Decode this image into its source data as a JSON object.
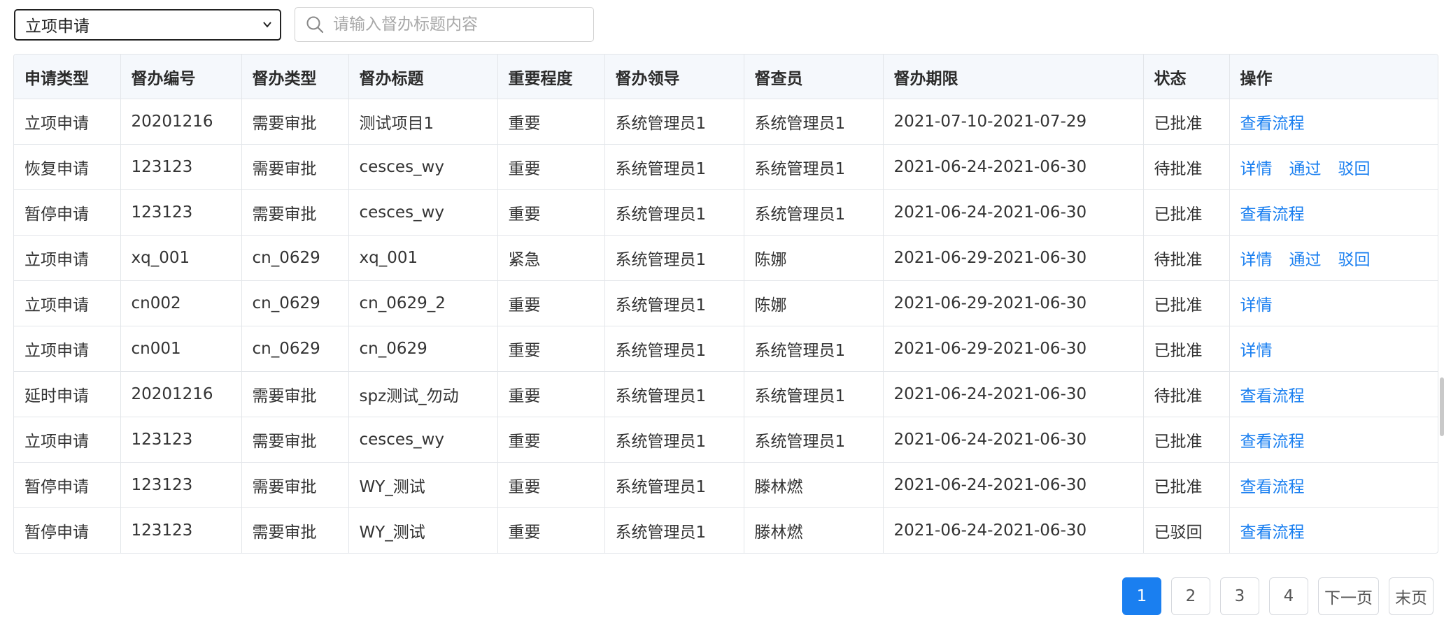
{
  "filter": {
    "selected": "立项申请",
    "search_placeholder": "请输入督办标题内容"
  },
  "table": {
    "columns": [
      "申请类型",
      "督办编号",
      "督办类型",
      "督办标题",
      "重要程度",
      "督办领导",
      "督查员",
      "督办期限",
      "状态",
      "操作"
    ],
    "rows": [
      {
        "type": "立项申请",
        "code": "20201216",
        "kind": "需要审批",
        "title": "测试项目1",
        "level": "重要",
        "leader": "系统管理员1",
        "inspector": "系统管理员1",
        "period": "2021-07-10-2021-07-29",
        "status": "已批准",
        "actions": [
          "查看流程"
        ]
      },
      {
        "type": "恢复申请",
        "code": "123123",
        "kind": "需要审批",
        "title": "cesces_wy",
        "level": "重要",
        "leader": "系统管理员1",
        "inspector": "系统管理员1",
        "period": "2021-06-24-2021-06-30",
        "status": "待批准",
        "actions": [
          "详情",
          "通过",
          "驳回"
        ]
      },
      {
        "type": "暂停申请",
        "code": "123123",
        "kind": "需要审批",
        "title": "cesces_wy",
        "level": "重要",
        "leader": "系统管理员1",
        "inspector": "系统管理员1",
        "period": "2021-06-24-2021-06-30",
        "status": "已批准",
        "actions": [
          "查看流程"
        ]
      },
      {
        "type": "立项申请",
        "code": "xq_001",
        "kind": "cn_0629",
        "title": "xq_001",
        "level": "紧急",
        "leader": "系统管理员1",
        "inspector": "陈娜",
        "period": "2021-06-29-2021-06-30",
        "status": "待批准",
        "actions": [
          "详情",
          "通过",
          "驳回"
        ]
      },
      {
        "type": "立项申请",
        "code": "cn002",
        "kind": "cn_0629",
        "title": "cn_0629_2",
        "level": "重要",
        "leader": "系统管理员1",
        "inspector": "陈娜",
        "period": "2021-06-29-2021-06-30",
        "status": "已批准",
        "actions": [
          "详情"
        ]
      },
      {
        "type": "立项申请",
        "code": "cn001",
        "kind": "cn_0629",
        "title": "cn_0629",
        "level": "重要",
        "leader": "系统管理员1",
        "inspector": "系统管理员1",
        "period": "2021-06-29-2021-06-30",
        "status": "已批准",
        "actions": [
          "详情"
        ]
      },
      {
        "type": "延时申请",
        "code": "20201216",
        "kind": "需要审批",
        "title": "spz测试_勿动",
        "level": "重要",
        "leader": "系统管理员1",
        "inspector": "系统管理员1",
        "period": "2021-06-24-2021-06-30",
        "status": "待批准",
        "actions": [
          "查看流程"
        ]
      },
      {
        "type": "立项申请",
        "code": "123123",
        "kind": "需要审批",
        "title": "cesces_wy",
        "level": "重要",
        "leader": "系统管理员1",
        "inspector": "系统管理员1",
        "period": "2021-06-24-2021-06-30",
        "status": "已批准",
        "actions": [
          "查看流程"
        ]
      },
      {
        "type": "暂停申请",
        "code": "123123",
        "kind": "需要审批",
        "title": "WY_测试",
        "level": "重要",
        "leader": "系统管理员1",
        "inspector": "滕林燃",
        "period": "2021-06-24-2021-06-30",
        "status": "已批准",
        "actions": [
          "查看流程"
        ]
      },
      {
        "type": "暂停申请",
        "code": "123123",
        "kind": "需要审批",
        "title": "WY_测试",
        "level": "重要",
        "leader": "系统管理员1",
        "inspector": "滕林燃",
        "period": "2021-06-24-2021-06-30",
        "status": "已驳回",
        "actions": [
          "查看流程"
        ]
      }
    ]
  },
  "pagination": {
    "pages": [
      "1",
      "2",
      "3",
      "4"
    ],
    "current": "1",
    "next_label": "下一页",
    "last_label": "末页"
  },
  "colors": {
    "accent": "#1a7ff0",
    "header_bg": "#f5f8fc",
    "border": "#e3e6ea"
  }
}
